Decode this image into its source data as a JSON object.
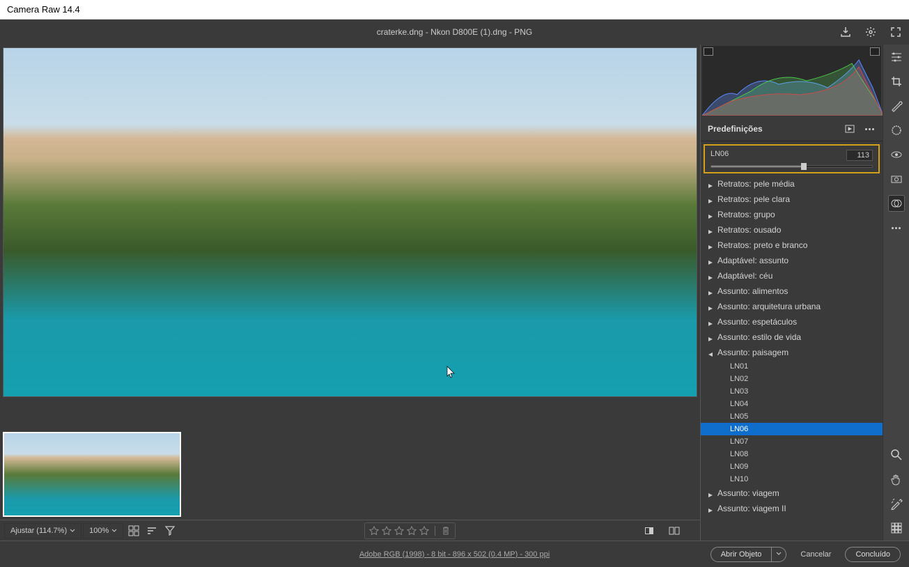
{
  "app": {
    "title": "Camera Raw 14.4"
  },
  "header": {
    "filename": "craterke.dng - Nkon D800E (1).dng  -  PNG"
  },
  "panel": {
    "title": "Predefinições",
    "amount_label": "LN06",
    "amount_value": "113"
  },
  "presets": {
    "groups": [
      {
        "label": "Retratos: pele média",
        "open": false
      },
      {
        "label": "Retratos: pele clara",
        "open": false
      },
      {
        "label": "Retratos: grupo",
        "open": false
      },
      {
        "label": "Retratos: ousado",
        "open": false
      },
      {
        "label": "Retratos: preto e branco",
        "open": false
      },
      {
        "label": "Adaptável: assunto",
        "open": false
      },
      {
        "label": "Adaptável: céu",
        "open": false
      },
      {
        "label": "Assunto: alimentos",
        "open": false
      },
      {
        "label": "Assunto: arquitetura urbana",
        "open": false
      },
      {
        "label": "Assunto: espetáculos",
        "open": false
      },
      {
        "label": "Assunto: estilo de vida",
        "open": false
      },
      {
        "label": "Assunto: paisagem",
        "open": true,
        "items": [
          "LN01",
          "LN02",
          "LN03",
          "LN04",
          "LN05",
          "LN06",
          "LN07",
          "LN08",
          "LN09",
          "LN10"
        ],
        "selected": "LN06"
      },
      {
        "label": "Assunto: viagem",
        "open": false
      },
      {
        "label": "Assunto: viagem II",
        "open": false
      }
    ]
  },
  "toolbar": {
    "fit_label": "Ajustar (114.7%)",
    "zoom_label": "100%"
  },
  "footer": {
    "info": "Adobe RGB (1998) - 8 bit - 896 x 502 (0.4 MP) - 300 ppi",
    "open_object": "Abrir Objeto",
    "cancel": "Cancelar",
    "done": "Concluído"
  }
}
